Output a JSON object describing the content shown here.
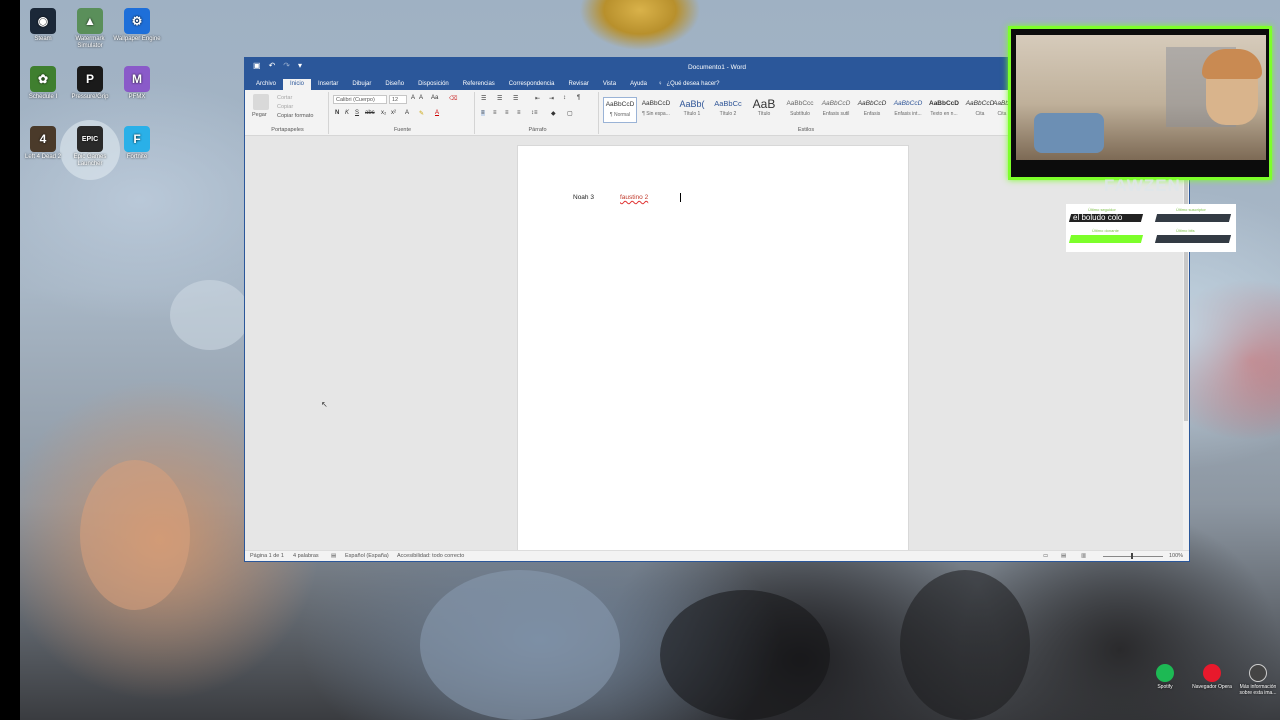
{
  "desktop_icons": [
    {
      "label": "Steam",
      "icon": "steam-icon",
      "color": "#1b2838"
    },
    {
      "label": "Watermark Simulator",
      "icon": "watermark-icon",
      "color": "#5a8f5a"
    },
    {
      "label": "Wallpaper Engine",
      "icon": "wallpaper-engine-icon",
      "color": "#1e6fd9"
    },
    {
      "label": "Schedule I",
      "icon": "schedule-icon",
      "color": "#3f7f2f"
    },
    {
      "label": "Pressure/Grip",
      "icon": "pressure-icon",
      "color": "#1a1a1a"
    },
    {
      "label": "PFMX",
      "icon": "pfmx-icon",
      "color": "#8a5ac9"
    },
    {
      "label": "Left 4 Dead 2",
      "icon": "l4d2-icon",
      "color": "#4a3a2a"
    },
    {
      "label": "Epic Games Launcher",
      "icon": "epic-games-icon",
      "color": "#2a2a2a"
    },
    {
      "label": "Fortnite",
      "icon": "fortnite-icon",
      "color": "#2ab0e8"
    }
  ],
  "word": {
    "title": "Documento1 - Word",
    "menu": [
      "Archivo",
      "Inicio",
      "Insertar",
      "Dibujar",
      "Diseño",
      "Disposición",
      "Referencias",
      "Correspondencia",
      "Revisar",
      "Vista",
      "Ayuda"
    ],
    "tell_me": "¿Qué desea hacer?",
    "clipboard": {
      "paste": "Pegar",
      "cut": "Cortar",
      "copy": "Copiar",
      "format_painter": "Copiar formato",
      "label": "Portapapeles"
    },
    "font": {
      "name": "Calibri (Cuerpo)",
      "size": "12",
      "label": "Fuente"
    },
    "paragraph_label": "Párrafo",
    "styles_label": "Estilos",
    "styles": [
      {
        "preview": "AaBbCcD",
        "name": "¶ Normal"
      },
      {
        "preview": "AaBbCcD",
        "name": "¶ Sin espa..."
      },
      {
        "preview": "AaBb(",
        "name": "Título 1"
      },
      {
        "preview": "AaBbCc",
        "name": "Título 2"
      },
      {
        "preview": "AaB",
        "name": "Título"
      },
      {
        "preview": "AaBbCcc",
        "name": "Subtítulo"
      },
      {
        "preview": "AaBbCcD",
        "name": "Énfasis sutil"
      },
      {
        "preview": "AaBbCcD",
        "name": "Énfasis"
      },
      {
        "preview": "AaBbCcD",
        "name": "Énfasis int..."
      },
      {
        "preview": "AaBbCcD",
        "name": "Texto en n..."
      },
      {
        "preview": "AaBbCcD",
        "name": "Cita"
      },
      {
        "preview": "AaBbCcD",
        "name": "Cita"
      }
    ],
    "document": {
      "word1": "Noah 3",
      "word2": "faustino 2"
    },
    "status": {
      "page": "Página 1 de 1",
      "words": "4 palabras",
      "language": "Español (España)",
      "accessibility": "Accesibilidad: todo correcto",
      "zoom": "100%"
    }
  },
  "stream": {
    "name": "FAWZEN",
    "goal_main": "el boludo colo",
    "goal_labels": [
      "Último seguidor",
      "Último suscriptor",
      "Último donante",
      "Último bits"
    ]
  },
  "tray": [
    {
      "label": "Spotify",
      "color": "#1db954"
    },
    {
      "label": "Navegador Opera",
      "color": "#e8192c"
    },
    {
      "label": "Más información sobre esta ima...",
      "color": "#444444"
    }
  ]
}
